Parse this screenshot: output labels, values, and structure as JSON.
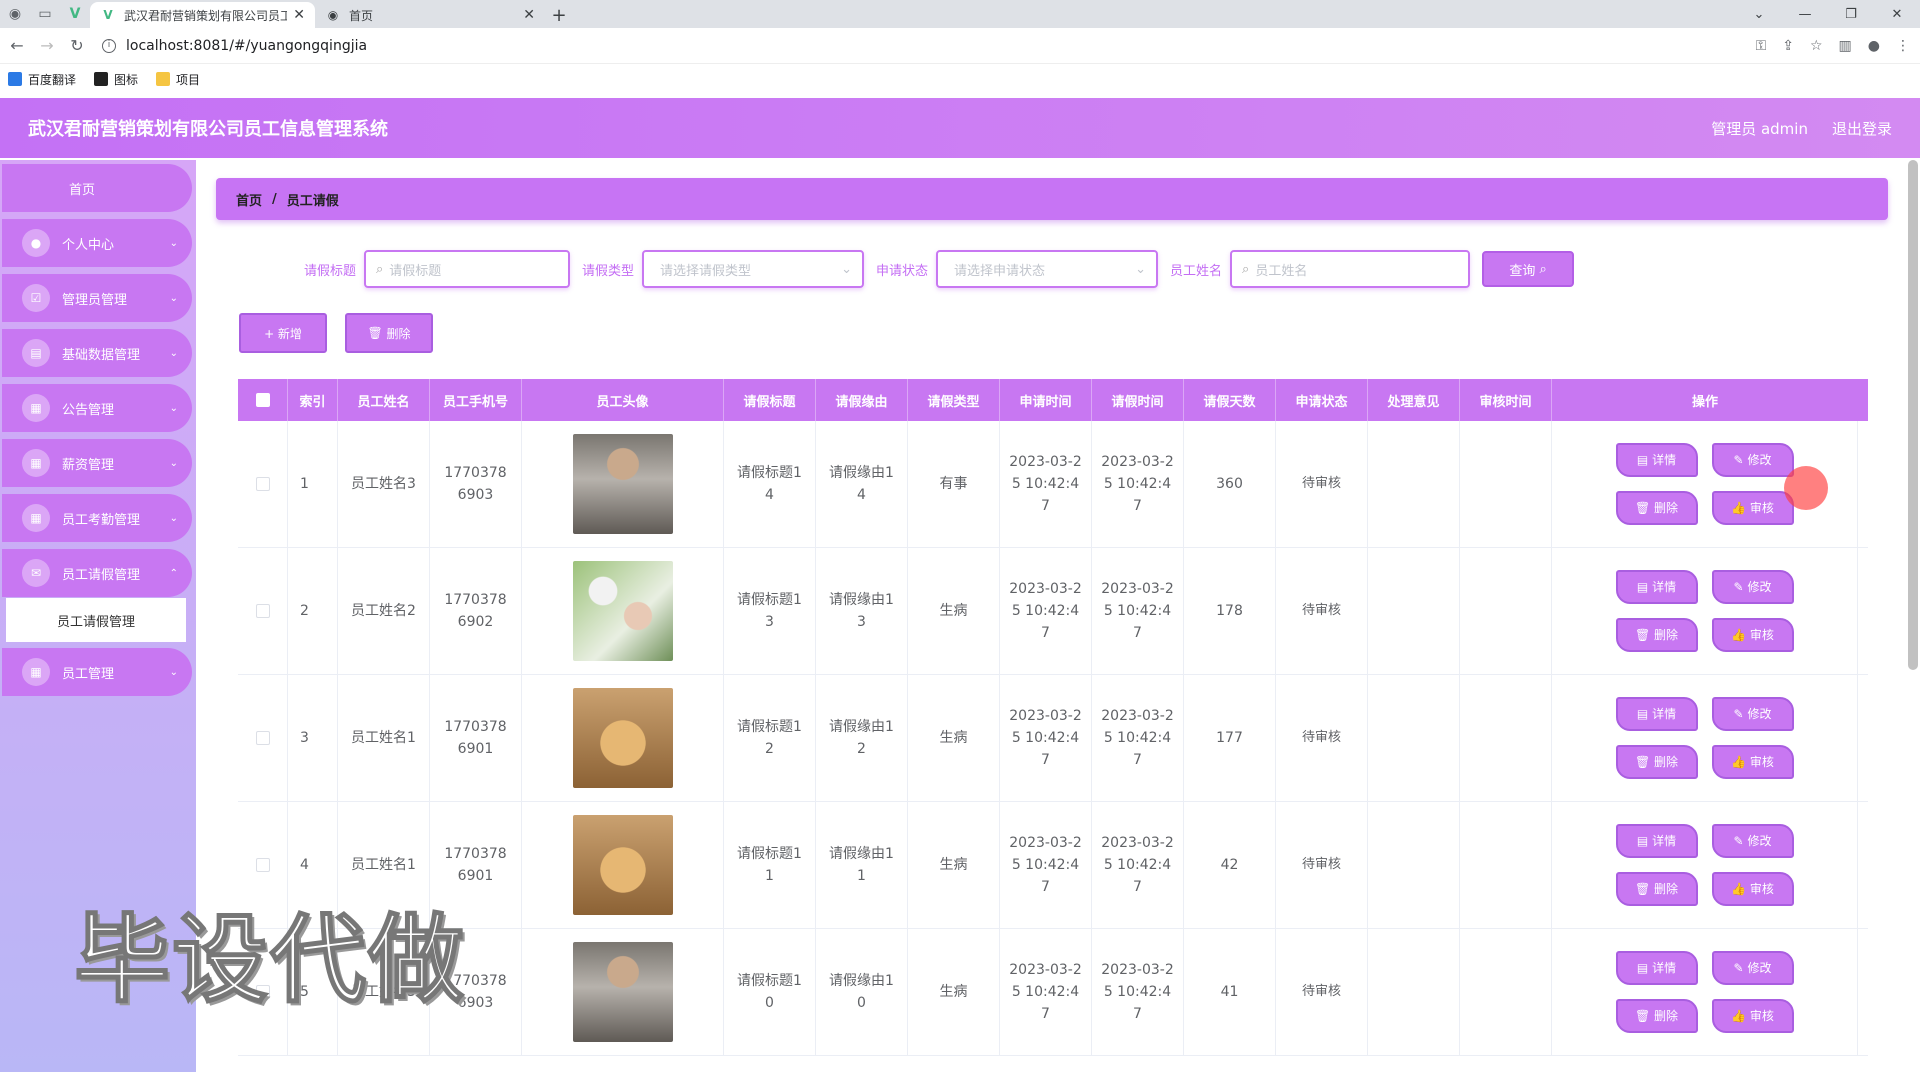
{
  "browser": {
    "tabs": [
      {
        "title": "武汉君耐营销策划有限公司员工信息管理系统",
        "active": true
      },
      {
        "title": "首页",
        "active": false
      }
    ],
    "url": "localhost:8081/#/yuangongqingjia",
    "bookmarks": [
      "百度翻译",
      "图标",
      "项目"
    ]
  },
  "app": {
    "title": "武汉君耐营销策划有限公司员工信息管理系统",
    "user": "管理员 admin",
    "logout": "退出登录"
  },
  "sidebar": {
    "home": "首页",
    "items": [
      {
        "label": "个人中心"
      },
      {
        "label": "管理员管理"
      },
      {
        "label": "基础数据管理"
      },
      {
        "label": "公告管理"
      },
      {
        "label": "薪资管理"
      },
      {
        "label": "员工考勤管理"
      },
      {
        "label": "员工请假管理"
      },
      {
        "label": "员工管理"
      }
    ],
    "submenu": "员工请假管理"
  },
  "breadcrumb": {
    "home": "首页",
    "sep": "/",
    "current": "员工请假"
  },
  "search": {
    "title_label": "请假标题",
    "title_placeholder": "请假标题",
    "type_label": "请假类型",
    "type_placeholder": "请选择请假类型",
    "status_label": "申请状态",
    "status_placeholder": "请选择申请状态",
    "name_label": "员工姓名",
    "name_placeholder": "员工姓名",
    "query": "查询"
  },
  "actions": {
    "add": "+ 新增",
    "delete": "删除"
  },
  "table": {
    "headers": [
      "索引",
      "员工姓名",
      "员工手机号",
      "员工头像",
      "请假标题",
      "请假缘由",
      "请假类型",
      "申请时间",
      "请假时间",
      "请假天数",
      "申请状态",
      "处理意见",
      "审核时间",
      "操作"
    ],
    "ops": {
      "detail": "详情",
      "edit": "修改",
      "delete": "删除",
      "review": "审核"
    },
    "rows": [
      {
        "idx": "1",
        "name": "员工姓名3",
        "phone": "17703786903",
        "title": "请假标题14",
        "reason": "请假缘由14",
        "type": "有事",
        "apply": "2023-03-25 10:42:47",
        "leave": "2023-03-25 10:42:47",
        "days": "360",
        "status": "待审核",
        "avatar": "man"
      },
      {
        "idx": "2",
        "name": "员工姓名2",
        "phone": "17703786902",
        "title": "请假标题13",
        "reason": "请假缘由13",
        "type": "生病",
        "apply": "2023-03-25 10:42:47",
        "leave": "2023-03-25 10:42:47",
        "days": "178",
        "status": "待审核",
        "avatar": "flower"
      },
      {
        "idx": "3",
        "name": "员工姓名1",
        "phone": "17703786901",
        "title": "请假标题12",
        "reason": "请假缘由12",
        "type": "生病",
        "apply": "2023-03-25 10:42:47",
        "leave": "2023-03-25 10:42:47",
        "days": "177",
        "status": "待审核",
        "avatar": "dog"
      },
      {
        "idx": "4",
        "name": "员工姓名1",
        "phone": "17703786901",
        "title": "请假标题11",
        "reason": "请假缘由11",
        "type": "生病",
        "apply": "2023-03-25 10:42:47",
        "leave": "2023-03-25 10:42:47",
        "days": "42",
        "status": "待审核",
        "avatar": "dog"
      },
      {
        "idx": "5",
        "name": "员工姓名3",
        "phone": "17703786903",
        "title": "请假标题10",
        "reason": "请假缘由10",
        "type": "生病",
        "apply": "2023-03-25 10:42:47",
        "leave": "2023-03-25 10:42:47",
        "days": "41",
        "status": "待审核",
        "avatar": "man"
      }
    ]
  },
  "watermark": "毕设代做"
}
